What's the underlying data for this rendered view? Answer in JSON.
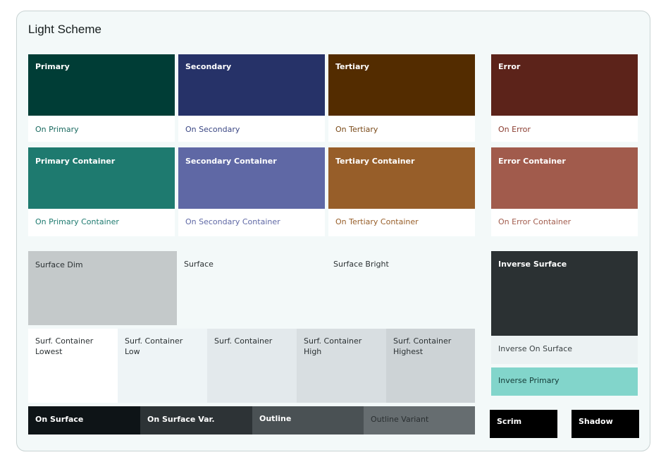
{
  "title": "Light Scheme",
  "colors": {
    "primary": "#003d36",
    "secondary": "#263268",
    "tertiary": "#532c00",
    "error": "#5c231a",
    "primary_container": "#1e7a6f",
    "secondary_container": "#5f68a5",
    "tertiary_container": "#975e29",
    "error_container": "#a15b4c"
  },
  "palette": {
    "primary": "Primary",
    "on_primary": "On Primary",
    "secondary": "Secondary",
    "on_secondary": "On Secondary",
    "tertiary": "Tertiary",
    "on_tertiary": "On Tertiary",
    "error": "Error",
    "on_error": "On Error",
    "primary_container": "Primary Container",
    "on_primary_container": "On Primary Container",
    "secondary_container": "Secondary Container",
    "on_secondary_container": "On Secondary Container",
    "tertiary_container": "Tertiary Container",
    "on_tertiary_container": "On Tertiary Container",
    "error_container": "Error Container",
    "on_error_container": "On Error Container"
  },
  "surface": {
    "surface_dim": "Surface Dim",
    "surface": "Surface",
    "surface_bright": "Surface Bright",
    "container_lowest": "Surf. Container Lowest",
    "container_low": "Surf. Container Low",
    "container": "Surf. Container",
    "container_high": "Surf. Container High",
    "container_highest": "Surf. Container Highest",
    "on_surface": "On Surface",
    "on_surface_variant": "On Surface Var.",
    "outline": "Outline",
    "outline_variant": "Outline Variant"
  },
  "inverse": {
    "inverse_surface": "Inverse Surface",
    "inverse_on_surface": "Inverse On Surface",
    "inverse_primary": "Inverse Primary"
  },
  "misc": {
    "scrim": "Scrim",
    "shadow": "Shadow"
  }
}
